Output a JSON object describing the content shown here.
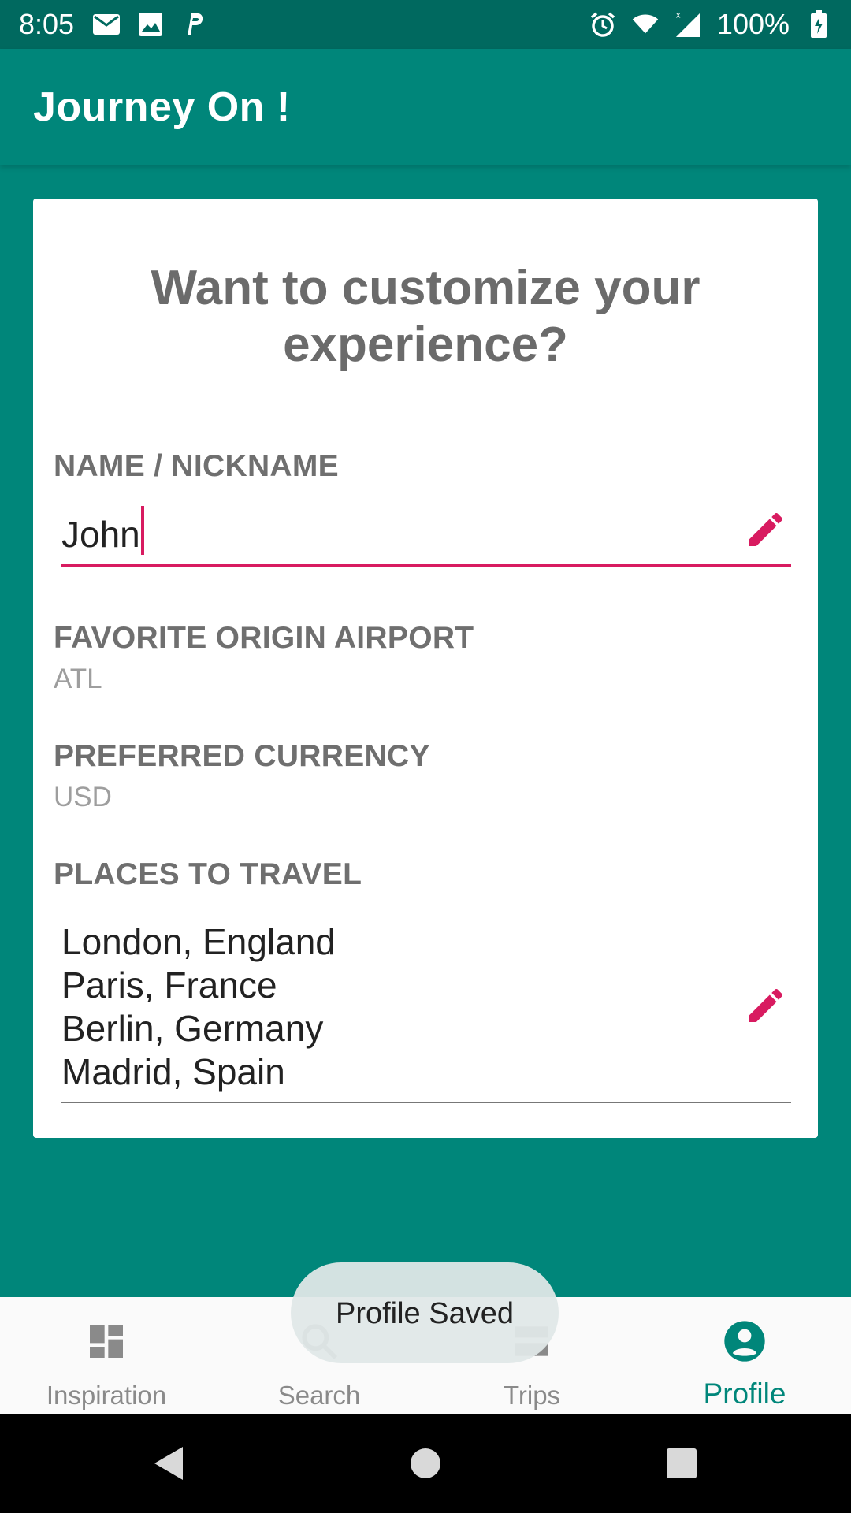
{
  "status_bar": {
    "time": "8:05",
    "battery": "100%",
    "left_icons": [
      "mail-icon",
      "image-icon",
      "parking-icon"
    ],
    "right_icons": [
      "alarm-icon",
      "wifi-icon",
      "signal-icon",
      "battery-icon"
    ]
  },
  "app_bar": {
    "title": "Journey On !"
  },
  "card": {
    "heading_line1": "Want to customize your",
    "heading_line2": "experience?",
    "name_label": "NAME / NICKNAME",
    "name_value": "John",
    "airport_label": "FAVORITE ORIGIN AIRPORT",
    "airport_value": "ATL",
    "currency_label": "PREFERRED CURRENCY",
    "currency_value": "USD",
    "places_label": "PLACES TO TRAVEL",
    "places": [
      "London, England",
      "Paris, France",
      "Berlin, Germany",
      "Madrid, Spain"
    ]
  },
  "snackbar": {
    "message": "Profile Saved"
  },
  "bottom_nav": {
    "items": [
      {
        "label": "Inspiration",
        "icon": "dashboard-icon",
        "active": false
      },
      {
        "label": "Search",
        "icon": "search-icon",
        "active": false
      },
      {
        "label": "Trips",
        "icon": "trips-icon",
        "active": false
      },
      {
        "label": "Profile",
        "icon": "profile-icon",
        "active": true
      }
    ]
  },
  "colors": {
    "primary": "#00867a",
    "primary_dark": "#00695f",
    "accent": "#d81b60",
    "inactive": "#8a8a8a"
  }
}
